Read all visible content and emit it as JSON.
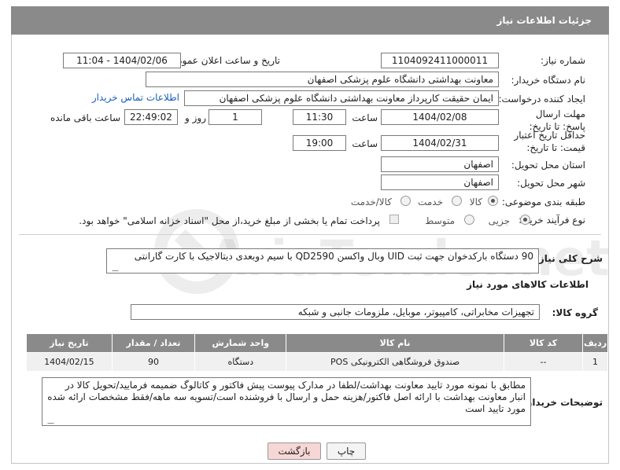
{
  "header": {
    "title": "جزئیات اطلاعات نیاز"
  },
  "fields": {
    "need_number_label": "شماره نیاز:",
    "need_number": "1104092411000011",
    "announce_label": "تاریخ و ساعت اعلان عمومی:",
    "announce_value": "1404/02/06 - 11:04",
    "buyer_org_label": "نام دستگاه خریدار:",
    "buyer_org": "معاونت بهداشتی دانشگاه علوم پزشکی اصفهان",
    "creator_label": "ایجاد کننده درخواست:",
    "creator": "ایمان حقیقت کارپرداز معاونت بهداشتی دانشگاه علوم پزشکی اصفهان",
    "buyer_contact_link": "اطلاعات تماس خریدار",
    "deadline_label": "مهلت ارسال پاسخ: تا تاریخ:",
    "deadline_date": "1404/02/08",
    "time_label": "ساعت",
    "deadline_time": "11:30",
    "days_count": "1",
    "days_label": "روز و",
    "remaining_time": "22:49:02",
    "remaining_label": "ساعت باقی مانده",
    "validity_label": "حداقل تاریخ اعتبار قیمت: تا تاریخ:",
    "validity_date": "1404/02/31",
    "validity_time_label": "ساعت",
    "validity_time": "19:00",
    "province_label": "استان محل تحویل:",
    "province": "اصفهان",
    "city_label": "شهر محل تحویل:",
    "city": "اصفهان",
    "category_label": "طبقه بندی موضوعی:",
    "category_options": [
      "کالا",
      "خدمت",
      "کالا/خدمت"
    ],
    "category_selected": 0,
    "process_label": "نوع فرآیند خرید :",
    "process_options": [
      "جزیی",
      "متوسط"
    ],
    "process_selected": 0,
    "payment_note": "پرداخت تمام یا بخشی از مبلغ خرید،از محل \"اسناد خزانه اسلامی\" خواهد بود."
  },
  "description": {
    "label": "شرح کلی نیاز:",
    "text": "90 دستگاه بارکدخوان جهت ثبت UID وبال واکسن QD2590 با سیم دوبعدی دیتالاجیک با کارت گارانتی"
  },
  "goods_info": {
    "title": "اطلاعات کالاهای مورد نیاز",
    "group_label": "گروه کالا:",
    "group_value": "تجهیزات مخابراتی، کامپیوتر، موبایل، ملزومات جانبی و شبکه"
  },
  "table": {
    "headers": [
      "ردیف",
      "کد کالا",
      "نام کالا",
      "واحد شمارش",
      "تعداد / مقدار",
      "تاریخ نیاز"
    ],
    "rows": [
      [
        "1",
        "--",
        "صندوق فروشگاهی الکترونیکی POS",
        "دستگاه",
        "90",
        "1404/02/15"
      ]
    ]
  },
  "buyer_notes": {
    "label": "توضیحات خریدار:",
    "text": "مطابق با نمونه مورد تایید معاونت بهداشت/لطفا در مدارک پیوست پیش فاکتور و کاتالوگ ضمیمه فرمایید/تحویل کالا در انبار معاونت بهداشت با ارائه اصل فاکتور/هزینه حمل و ارسال با فروشنده است/تسویه سه ماهه/فقط مشخصات ارائه شده مورد تایید است"
  },
  "buttons": {
    "print": "چاپ",
    "back": "بازگشت"
  },
  "watermark_text": "AriaTender.net",
  "colors": {
    "header_bg": "#8a8a8a",
    "link": "#1a5fb4",
    "back_btn_bg": "#f7d6d6"
  }
}
